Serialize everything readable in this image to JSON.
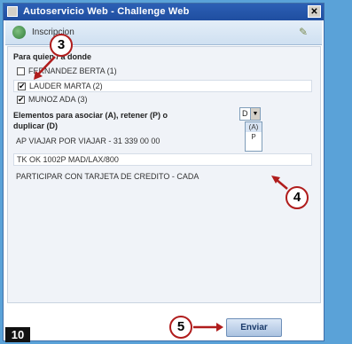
{
  "window": {
    "title": "Autoservicio Web - Challenge Web",
    "close_glyph": "✕"
  },
  "subheader": {
    "label": "Inscripcion"
  },
  "section_students": {
    "heading": "Para quien / a donde"
  },
  "students": [
    {
      "name": "FERNANDEZ BERTA (1)",
      "checked": false
    },
    {
      "name": "LAUDER MARTA (2)",
      "checked": true
    },
    {
      "name": "MUNOZ ADA (3)",
      "checked": true
    }
  ],
  "section_elements": {
    "heading_line1": "Elementos para asociar (A), retener (P) o",
    "heading_line2": "duplicar (D)"
  },
  "elements": [
    {
      "text": "AP VIAJAR POR VIAJAR - 31 339 00 00"
    },
    {
      "text": "TK OK 1002P MAD/LAX/800"
    },
    {
      "text": "PARTICIPAR CON TARJETA DE CREDITO - CADA"
    }
  ],
  "dropdown": {
    "value": "D",
    "options": [
      "(A)",
      "P"
    ]
  },
  "buttons": {
    "send": "Enviar"
  },
  "annotations": {
    "step3": "3",
    "step4": "4",
    "step5": "5",
    "page_number": "10",
    "accent_color": "#b01c1c"
  }
}
